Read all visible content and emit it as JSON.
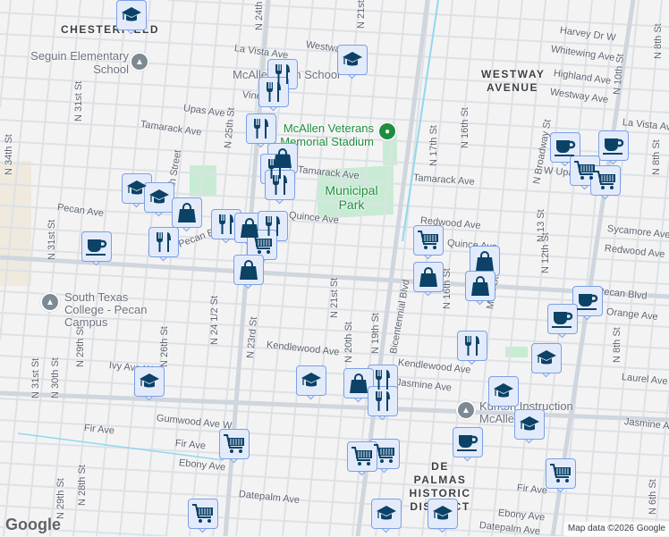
{
  "areas": {
    "chesterfield": "CHESTERFIELD",
    "westway": "WESTWAY AVENUE",
    "depalmas": "DE PALMAS HISTORIC DISTRICT"
  },
  "pois": {
    "seguin": "Seguin Elementary School",
    "mcallen_high": "McAllen High School",
    "veterans": "McAllen Veterans Memorial Stadium",
    "park": "Municipal Park",
    "stc": "South Texas College - Pecan Campus",
    "kumon": "Kumon Instruction McAllen"
  },
  "streets": {
    "a1": "La Vista Ave",
    "a2": "Westway Ave",
    "a3": "Harvey Dr W",
    "a4": "Whitewing Ave",
    "a5": "Highland Ave",
    "a6": "Westway Ave",
    "a7": "Upas Ave",
    "a8": "Tamarack Ave",
    "a9": "Tamarack Ave",
    "a10": "Tamarack Ave",
    "a11": "Pecan Ave",
    "a12": "Quince Ave",
    "a13": "Redwood Ave",
    "a14": "Quince Ave",
    "a15": "Sycamore Ave",
    "a16": "Redwood Ave",
    "a17": "Pecan Blvd",
    "a18": "Pecan Blvd",
    "a19": "Orange Ave",
    "a20": "Kendlewood Ave",
    "a21": "Kendlewood Ave",
    "a22": "Ivy Ave W",
    "a23": "Jasmine Ave",
    "a24": "Laurel Ave",
    "a25": "Jasmine Ave",
    "a26": "Gumwood Ave W",
    "a27": "Fir Ave",
    "a28": "Fir Ave",
    "a29": "Fir Ave",
    "a30": "Ebony Ave",
    "a31": "Ebony Ave",
    "a32": "Datepalm Ave",
    "a33": "Datepalm Ave",
    "a34": "W Upas Ave",
    "a35": "La Vista Ave",
    "a36": "Vine Ave",
    "s1": "N 24th St",
    "s2": "N 21st St",
    "s3": "N 34th St",
    "s4": "N 31st St",
    "s5": "N 31st St",
    "s6": "27th Street",
    "s7": "N 25th St",
    "s8": "N 23rd St",
    "s9": "N 17th St",
    "s10": "N 16th St",
    "s11": "N Broadway St",
    "s12": "N 13 St",
    "s13": "N 12th St",
    "s14": "N 10th St",
    "s15": "N 8th St",
    "s16": "N 8th St",
    "s17": "N 21st St",
    "s18": "N 20th St",
    "s19": "N 19th St",
    "s20": "Bicentennial Blvd",
    "s21": "N 24 1/2 St",
    "s22": "N 26th St",
    "s23": "N 29th St",
    "s24": "N 31st St",
    "s25": "N 30th St",
    "s26": "N 29th St",
    "s27": "N 28th St",
    "s28": "N 16th St",
    "s29": "N 8th St",
    "s30": "N 6th St",
    "s31": "Main St"
  },
  "markers": [
    "school",
    "school",
    "restaurant",
    "restaurant",
    "restaurant",
    "shopping",
    "restaurant",
    "restaurant",
    "school",
    "school",
    "shopping",
    "restaurant",
    "shopping",
    "restaurant",
    "grocery",
    "shopping",
    "restaurant",
    "coffee",
    "grocery",
    "shopping",
    "shopping",
    "shopping",
    "coffee",
    "coffee",
    "grocery",
    "grocery",
    "coffee",
    "coffee",
    "restaurant",
    "school",
    "school",
    "school",
    "coffee",
    "grocery",
    "restaurant",
    "shopping",
    "restaurant",
    "grocery",
    "grocery",
    "school",
    "school",
    "grocery",
    "school",
    "school",
    "grocery"
  ],
  "colors": {
    "marker_fill": "#e3ebfb",
    "marker_border": "#7aa0e6",
    "icon": "#0b4266",
    "park": "#c8ecd3",
    "canal": "#8fd8f0"
  },
  "footer": {
    "logo": "Google",
    "attribution": "Map data ©2026 Google"
  }
}
